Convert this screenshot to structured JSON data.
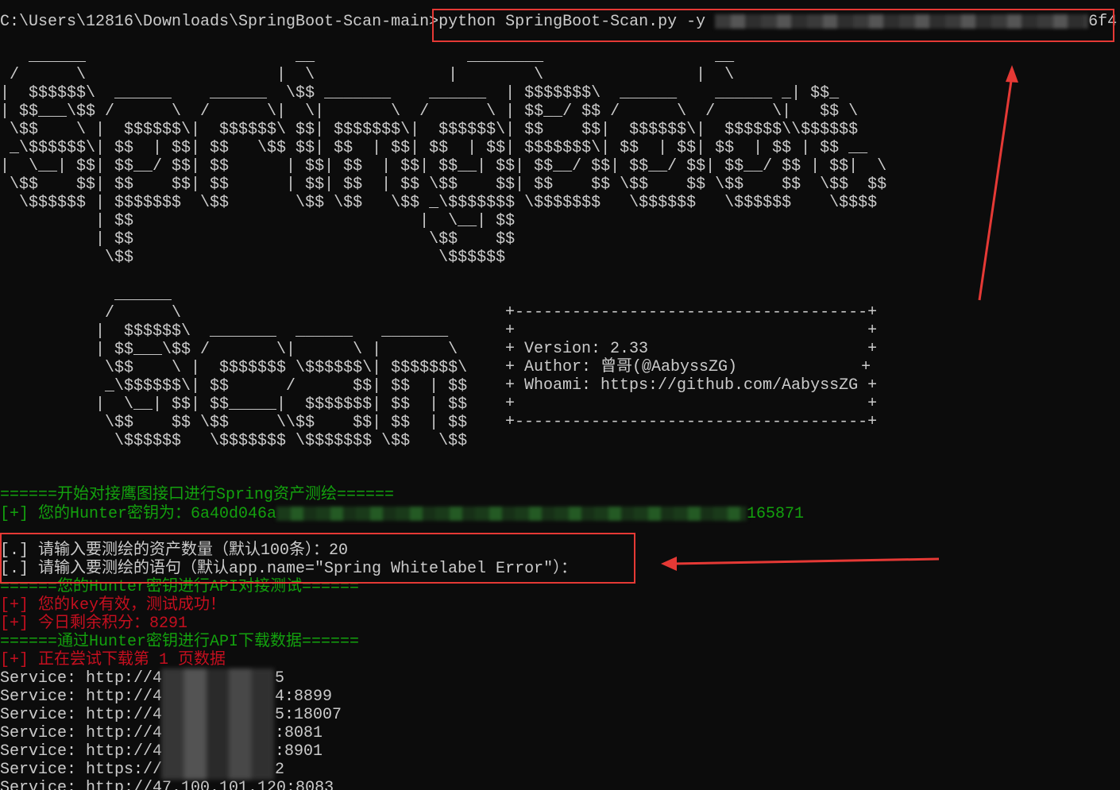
{
  "command": {
    "path": "C:\\Users\\12816\\Downloads\\SpringBoot-Scan-main>",
    "text": "python SpringBoot-Scan.py -y ",
    "tail": "6f4"
  },
  "banner": {
    "spring_art": "   ______                      __                ________                  __\n /      \\                    |  \\              |        \\                |  \\\n|  $$$$$$\\  ______    ______  \\$$ _______    ______  | $$$$$$$\\  ______    ______ _| $$_\n| $$___\\$$ /      \\  /      \\|  \\|       \\  /      \\ | $$__/ $$ /      \\  /      \\|   $$ \\\n \\$$    \\ |  $$$$$$\\|  $$$$$$\\ $$| $$$$$$$\\|  $$$$$$\\| $$    $$|  $$$$$$\\|  $$$$$$\\\\$$$$$$\n _\\$$$$$$\\| $$  | $$| $$   \\$$ $$| $$  | $$| $$  | $$| $$$$$$$\\| $$  | $$| $$  | $$ | $$ __\n|  \\__| $$| $$__/ $$| $$      | $$| $$  | $$| $$__| $$| $$__/ $$| $$__/ $$| $$__/ $$ | $$|  \\\n \\$$    $$| $$    $$| $$      | $$| $$  | $$ \\$$    $$| $$    $$ \\$$    $$ \\$$    $$  \\$$  $$\n  \\$$$$$$ | $$$$$$$  \\$$       \\$$ \\$$   \\$$ _\\$$$$$$$ \\$$$$$$$   \\$$$$$$   \\$$$$$$    \\$$$$\n          | $$                              |  \\__| $$\n          | $$                               \\$$    $$\n           \\$$                                \\$$$$$$",
    "scan_art": "            ______\n           /      \\\n          |  $$$$$$\\  _______  ______   _______\n          | $$___\\$$ /       \\|      \\ |       \\\n           \\$$    \\ |  $$$$$$$ \\$$$$$$\\| $$$$$$$\\\n           _\\$$$$$$\\| $$      /      $$| $$  | $$\n          |  \\__| $$| $$_____|  $$$$$$$| $$  | $$\n           \\$$    $$ \\$$     \\\\$$    $$| $$  | $$\n            \\$$$$$$   \\$$$$$$$ \\$$$$$$$ \\$$   \\$$",
    "info_border": "+-------------------------------------+",
    "info_empty": "+                                     +",
    "version": "+ Version: 2.33                       +",
    "author": "+ Author: 曾哥(@AabyssZG)             +",
    "whoami": "+ Whoami: https://github.com/AabyssZG +"
  },
  "output": {
    "start_hunter": "======开始对接鹰图接口进行Spring资产测绘======",
    "key_prefix": "[+] 您的Hunter密钥为：6a40d046a",
    "key_suffix": "165871",
    "prompt_count": "[.] 请输入要测绘的资产数量（默认100条）：20",
    "prompt_query": "[.] 请输入要测绘的语句（默认app.name=\"Spring Whitelabel Error\"）：",
    "api_test": "======您的Hunter密钥进行API对接测试======",
    "key_valid": "[+] 您的key有效，测试成功！",
    "points_left": "[+] 今日剩余积分：8291",
    "download_header": "======通过Hunter密钥进行API下载数据======",
    "downloading": "[+] 正在尝试下载第 1 页数据",
    "services": [
      {
        "prefix": "Service: http://4",
        "suffix": "5"
      },
      {
        "prefix": "Service: http://4",
        "suffix": "4:8899"
      },
      {
        "prefix": "Service: http://4",
        "suffix": "5:18007"
      },
      {
        "prefix": "Service: http://4",
        "suffix": ":8081"
      },
      {
        "prefix": "Service: http://4",
        "suffix": ":8901"
      },
      {
        "prefix": "Service: https://",
        "suffix": "2"
      }
    ],
    "last_partial": "Service: http://47.100.101.120:8083"
  },
  "colors": {
    "background": "#0c0c0c",
    "text": "#cccccc",
    "green": "#13a10e",
    "red": "#c50f1f",
    "annotation": "#e53935"
  }
}
